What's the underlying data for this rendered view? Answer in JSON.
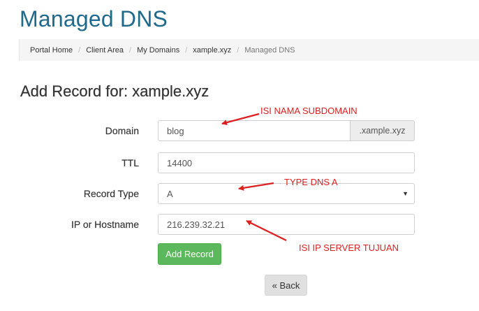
{
  "page": {
    "title": "Managed DNS"
  },
  "breadcrumb": [
    {
      "label": "Portal Home"
    },
    {
      "label": "Client Area"
    },
    {
      "label": "My Domains"
    },
    {
      "label": "xample.xyz"
    },
    {
      "label": "Managed DNS"
    }
  ],
  "breadcrumb_separator": "/",
  "form": {
    "heading": "Add Record for: xample.xyz",
    "domain": {
      "label": "Domain",
      "value": "blog",
      "suffix": ".xample.xyz"
    },
    "ttl": {
      "label": "TTL",
      "value": "14400"
    },
    "record_type": {
      "label": "Record Type",
      "value": "A",
      "caret": "▼"
    },
    "ip": {
      "label": "IP or Hostname",
      "value": "216.239.32.21"
    },
    "add_button": "Add Record",
    "back_button": "« Back"
  },
  "annotations": {
    "subdomain": "ISI NAMA SUBDOMAIN",
    "type": "TYPE DNS A",
    "ip": "ISI IP SERVER TUJUAN",
    "color": "#dd1f1f"
  },
  "colors": {
    "title": "#1f6a8c",
    "add_button": "#5cb85c",
    "back_button": "#e0e0e0",
    "breadcrumb_bg": "#f5f5f5"
  }
}
